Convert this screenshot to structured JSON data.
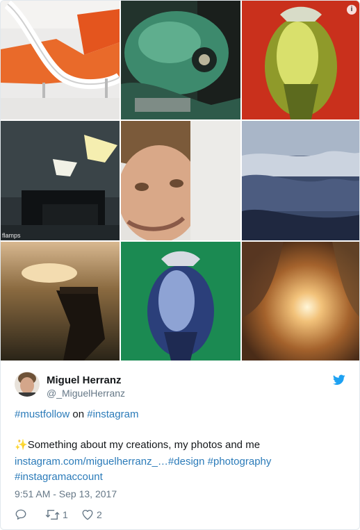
{
  "photo_grid": {
    "info_badge": "i",
    "watermark": "flamps"
  },
  "author": {
    "name": "Miguel Herranz",
    "handle": "@_MiguelHerranz"
  },
  "tweet": {
    "line1_tag1": "#mustfollow",
    "line1_mid": " on ",
    "line1_tag2": "#instagram",
    "sparkle": "✨",
    "line2_text": "Something about my creations, my photos and me",
    "line3_link": "instagram.com/miguelherranz_…",
    "line3_tag1": "#design",
    "line3_space": " ",
    "line3_tag2": "#photography",
    "line4_tag": "#instagramaccount"
  },
  "timestamp": "9:51 AM - Sep 13, 2017",
  "actions": {
    "retweet_count": "1",
    "like_count": "2"
  },
  "colors": {
    "link": "#2b7bb9",
    "twitter_blue": "#1da1f2",
    "muted": "#657786"
  }
}
